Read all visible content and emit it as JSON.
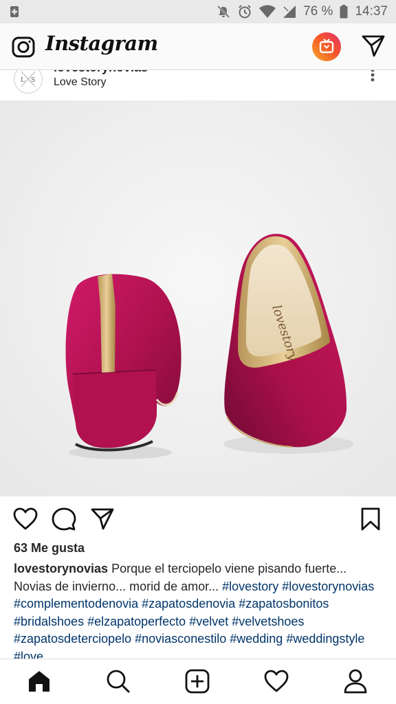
{
  "status_bar": {
    "battery_percent": "76 %",
    "time": "14:37",
    "icons": [
      "notification-icon",
      "mute-icon",
      "alarm-icon",
      "wifi-icon",
      "signal-icon",
      "battery-icon"
    ]
  },
  "app_bar": {
    "title": "Instagram",
    "icons": [
      "camera-icon",
      "igtv-icon",
      "direct-send-icon"
    ]
  },
  "post": {
    "username": "lovestorynovias",
    "location": "Love Story",
    "avatar_text": "L S",
    "likes": "63 Me gusta",
    "caption": {
      "author": "lovestorynovias",
      "text": "Porque el terciopelo viene pisando fuerte... Novias de invierno... morid de amor...",
      "hashtags": [
        "#lovestory",
        "#lovestorynovias",
        "#complementodenovia",
        "#zapatosdenovia",
        "#zapatosbonitos",
        "#bridalshoes",
        "#elzapatoperfecto",
        "#velvet",
        "#velvetshoes",
        "#zapatosdeterciopelo",
        "#noviasconestilo",
        "#wedding",
        "#weddingstyle",
        "#love"
      ]
    },
    "photo": {
      "insole_brand": "lovestory",
      "colors": {
        "velvet": "#b0124f",
        "gold": "#d8b97a",
        "background": "#efefef"
      }
    }
  },
  "actions": [
    "like-icon",
    "comment-icon",
    "share-icon",
    "save-icon"
  ],
  "bottom_nav": [
    "home-icon",
    "search-icon",
    "add-post-icon",
    "activity-icon",
    "profile-icon"
  ]
}
